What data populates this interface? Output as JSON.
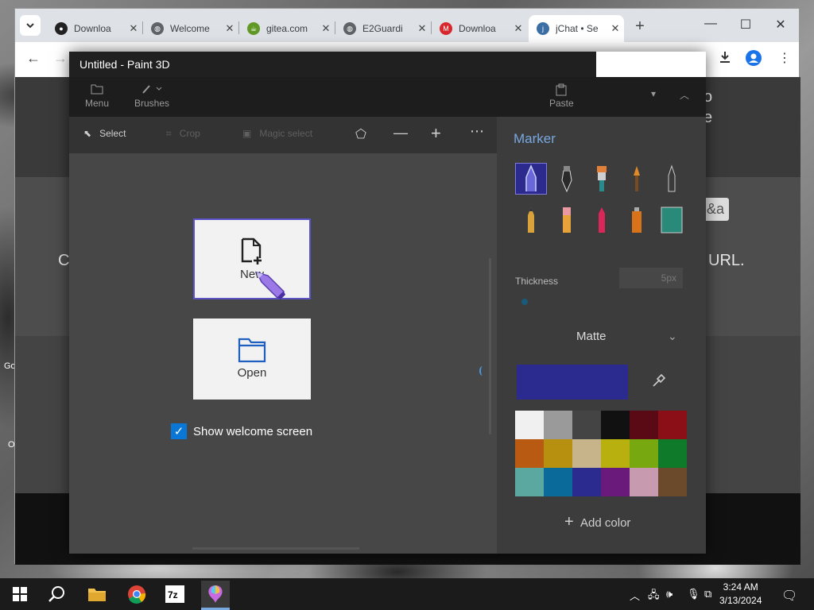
{
  "browser": {
    "tabs": [
      {
        "title": "Downloa",
        "favicon": "github-icon"
      },
      {
        "title": "Welcome",
        "favicon": "globe-icon"
      },
      {
        "title": "gitea.com",
        "favicon": "gitea-icon"
      },
      {
        "title": "E2Guardi",
        "favicon": "globe-icon"
      },
      {
        "title": "Downloa",
        "favicon": "mega-icon"
      },
      {
        "title": "jChat • Se",
        "favicon": "jchat-icon"
      }
    ],
    "tab_close": "✕",
    "new_tab": "+",
    "page": {
      "text_c": "C",
      "text_url": "URL.",
      "chip": "&a",
      "text_o": "o",
      "text_e": "e"
    }
  },
  "desktop": {
    "labels": [
      "Go",
      "O"
    ]
  },
  "paint": {
    "title": "Untitled - Paint 3D",
    "ribbon": {
      "menu": "Menu",
      "brushes": "Brushes",
      "paste": "Paste"
    },
    "tools": {
      "select": "Select",
      "crop": "Crop",
      "magic_select": "Magic select"
    },
    "welcome": {
      "new_label": "New",
      "open_label": "Open",
      "show_welcome": "Show welcome screen"
    },
    "side": {
      "title": "Marker",
      "thickness_label": "Thickness",
      "thickness_value": "5px",
      "finish": "Matte",
      "add_color": "Add color",
      "current_color": "#2b2a8f",
      "palette": [
        "#f0f0f0",
        "#9a9a9a",
        "#444444",
        "#111111",
        "#5a0a14",
        "#8b0f16",
        "#b85a12",
        "#b8900f",
        "#c8b48a",
        "#b8b00f",
        "#78a810",
        "#0e7a2a",
        "#5aa8a0",
        "#0a6a9a",
        "#2b2a8f",
        "#6a1a7a",
        "#c89ab0",
        "#6a4a2a"
      ]
    }
  },
  "taskbar": {
    "time": "3:24 AM",
    "date": "3/13/2024"
  }
}
